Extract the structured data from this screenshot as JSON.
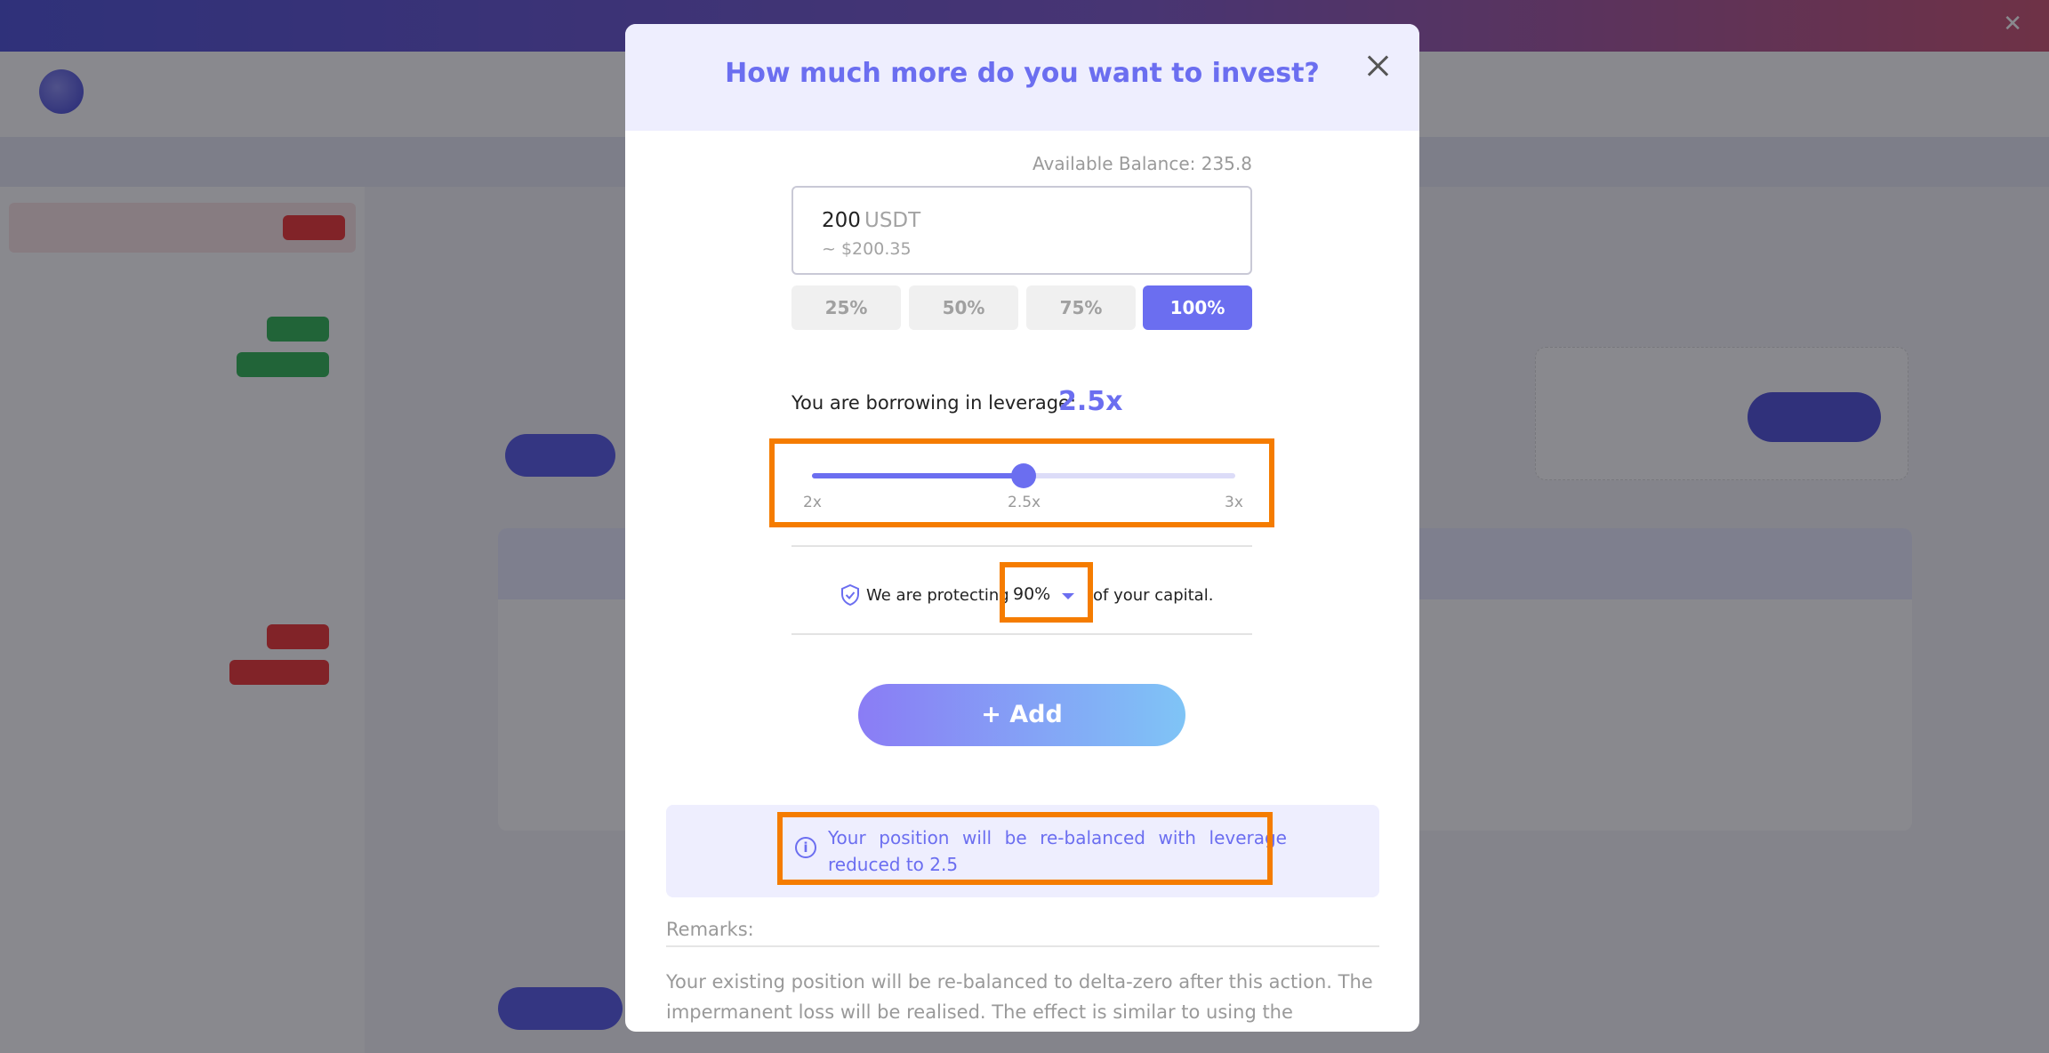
{
  "modal": {
    "title": "How much more do you want to invest?",
    "available_balance": "Available Balance: 235.8",
    "amount": {
      "value": "200",
      "unit": "USDT",
      "usd_equivalent": "~ $200.35"
    },
    "percent_buttons": [
      {
        "label": "25%",
        "selected": false
      },
      {
        "label": "50%",
        "selected": false
      },
      {
        "label": "75%",
        "selected": false
      },
      {
        "label": "100%",
        "selected": true
      }
    ],
    "leverage": {
      "label": "You are borrowing in leverage:",
      "value_text": "2.5x",
      "min": 2,
      "max": 3,
      "current": 2.5,
      "tick_labels": [
        "2x",
        "2.5x",
        "3x"
      ]
    },
    "protection": {
      "prefix": "We are protecting",
      "selected": "90%",
      "suffix": "of your capital."
    },
    "add_button": "+ Add",
    "info_message": "Your position will be re-balanced with leverage reduced to 2.5",
    "remarks": {
      "label": "Remarks:",
      "text": "Your existing position will be re-balanced to delta-zero after this action. The impermanent loss will be realised. The effect is similar to using the"
    }
  },
  "colors": {
    "accent": "#6b6ef0",
    "highlight": "#f57c00",
    "header_bg": "#eeeefe"
  },
  "icons": [
    "close-icon",
    "shield-check-icon",
    "info-icon",
    "caret-down-icon"
  ]
}
